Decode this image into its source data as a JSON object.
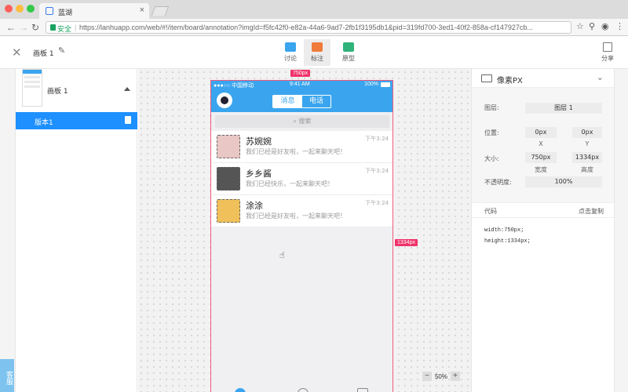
{
  "browser": {
    "tab_title": "蓝湖",
    "secure_label": "安全",
    "url": "https://lanhuapp.com/web/#!/item/board/annotation?imgId=f5fc42f0-e82a-44a6-9ad7-2fb1f3195db1&pid=319fd700-3ed1-40f2-858a-cf147927cb..."
  },
  "header": {
    "board_name": "画板 1",
    "tools": [
      {
        "label": "讨论",
        "color": "#3aa5ee"
      },
      {
        "label": "标注",
        "color": "#f07a3a"
      },
      {
        "label": "原型",
        "color": "#2fb37a"
      }
    ],
    "share_label": "分享"
  },
  "left_panel": {
    "board_label": "画板 1",
    "version_label": "版本1",
    "support_label": "客服"
  },
  "canvas": {
    "width_badge": "750px",
    "height_badge": "1334px",
    "zoom": "50%",
    "phone": {
      "carrier": "●●●○○ 中国移动 ",
      "time": "9:41 AM",
      "battery": "100%",
      "seg_a": "消息",
      "seg_b": "电话",
      "search_placeholder": "搜索",
      "conversations": [
        {
          "name": "苏婉婉",
          "message": "我们已经是好友啦，一起来聊天吧！",
          "time": "下午3:24"
        },
        {
          "name": "乡乡酱",
          "message": "我们已经快乐，一起来聊天吧！",
          "time": "下午3:24"
        },
        {
          "name": "涂涂",
          "message": "我们已经是好友啦，一起来聊天吧！",
          "time": "下午3:24"
        }
      ]
    }
  },
  "right_panel": {
    "unit": "像素PX",
    "layer_label": "图层:",
    "layer_value": "图层 1",
    "position_label": "位置:",
    "x_value": "0px",
    "y_value": "0px",
    "x_sub": "X",
    "y_sub": "Y",
    "size_label": "大小:",
    "width_value": "750px",
    "height_value": "1334px",
    "width_sub": "宽度",
    "height_sub": "高度",
    "opacity_label": "不透明度:",
    "opacity_value": "100%",
    "code_label": "代码",
    "copy_label": "点击复制",
    "code_lines": [
      "width:750px;",
      "height:1334px;"
    ]
  }
}
